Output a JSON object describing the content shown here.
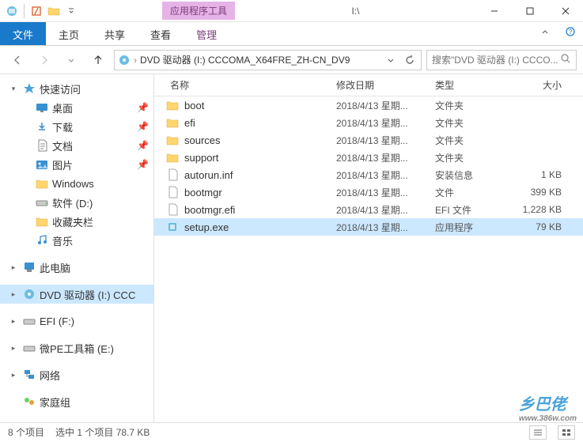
{
  "window": {
    "tool_tab": "应用程序工具",
    "title": "I:\\"
  },
  "ribbon": {
    "file": "文件",
    "home": "主页",
    "share": "共享",
    "view": "查看",
    "manage": "管理"
  },
  "address": {
    "path": "DVD 驱动器 (I:) CCCOMA_X64FRE_ZH-CN_DV9",
    "search_placeholder": "搜索\"DVD 驱动器 (I:) CCCO..."
  },
  "sidebar": {
    "quick_access": "快速访问",
    "desktop": "桌面",
    "downloads": "下载",
    "documents": "文档",
    "pictures": "图片",
    "windows": "Windows",
    "software_d": "软件 (D:)",
    "favorites_bar": "收藏夹栏",
    "music": "音乐",
    "this_pc": "此电脑",
    "dvd": "DVD 驱动器 (I:) CCC",
    "efi": "EFI (F:)",
    "wepe": "微PE工具箱 (E:)",
    "network": "网络",
    "homegroup": "家庭组"
  },
  "columns": {
    "name": "名称",
    "date": "修改日期",
    "type": "类型",
    "size": "大小"
  },
  "files": [
    {
      "icon": "folder",
      "name": "boot",
      "date": "2018/4/13 星期...",
      "type": "文件夹",
      "size": ""
    },
    {
      "icon": "folder",
      "name": "efi",
      "date": "2018/4/13 星期...",
      "type": "文件夹",
      "size": ""
    },
    {
      "icon": "folder",
      "name": "sources",
      "date": "2018/4/13 星期...",
      "type": "文件夹",
      "size": ""
    },
    {
      "icon": "folder",
      "name": "support",
      "date": "2018/4/13 星期...",
      "type": "文件夹",
      "size": ""
    },
    {
      "icon": "file",
      "name": "autorun.inf",
      "date": "2018/4/13 星期...",
      "type": "安装信息",
      "size": "1 KB"
    },
    {
      "icon": "file",
      "name": "bootmgr",
      "date": "2018/4/13 星期...",
      "type": "文件",
      "size": "399 KB"
    },
    {
      "icon": "file",
      "name": "bootmgr.efi",
      "date": "2018/4/13 星期...",
      "type": "EFI 文件",
      "size": "1,228 KB"
    },
    {
      "icon": "exe",
      "name": "setup.exe",
      "date": "2018/4/13 星期...",
      "type": "应用程序",
      "size": "79 KB",
      "selected": true
    }
  ],
  "status": {
    "count": "8 个项目",
    "selected": "选中 1 个项目 78.7 KB"
  },
  "watermark": {
    "text": "乡巴佬",
    "url": "www.386w.com"
  }
}
